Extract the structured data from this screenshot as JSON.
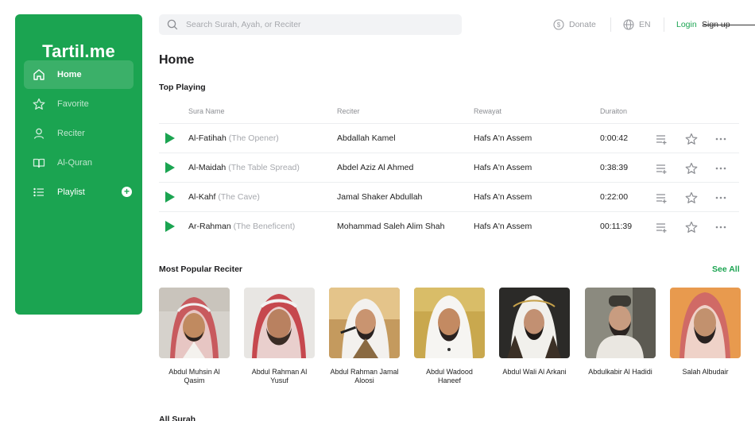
{
  "app": {
    "logo": "Tartil.me",
    "accent": "#1ba451"
  },
  "sidebar": {
    "items": [
      {
        "label": "Home",
        "icon": "home-icon",
        "active": true
      },
      {
        "label": "Favorite",
        "icon": "star-icon",
        "active": false
      },
      {
        "label": "Reciter",
        "icon": "user-icon",
        "active": false
      },
      {
        "label": "Al-Quran",
        "icon": "book-icon",
        "active": false
      },
      {
        "label": "Playlist",
        "icon": "list-icon",
        "active": false,
        "action_icon": "plus-icon"
      }
    ]
  },
  "header": {
    "search_placeholder": "Search Surah, Ayah, or Reciter",
    "donate_label": "Donate",
    "language_label": "EN",
    "login_label": "Login",
    "signup_label": "Sign up"
  },
  "main": {
    "title": "Home",
    "top_playing": {
      "title": "Top Playing",
      "columns": [
        "Sura Name",
        "Reciter",
        "Rewayat",
        "Duraiton"
      ],
      "rows": [
        {
          "sura": "Al-Fatihah",
          "meaning": "(The Opener)",
          "reciter": "Abdallah Kamel",
          "rewayat": "Hafs A'n Assem",
          "duration": "0:00:42"
        },
        {
          "sura": "Al-Maidah",
          "meaning": "(The Table Spread)",
          "reciter": "Abdel Aziz Al Ahmed",
          "rewayat": "Hafs A'n Assem",
          "duration": "0:38:39"
        },
        {
          "sura": "Al-Kahf",
          "meaning": "(The Cave)",
          "reciter": "Jamal Shaker Abdullah",
          "rewayat": "Hafs A'n Assem",
          "duration": "0:22:00"
        },
        {
          "sura": "Ar-Rahman",
          "meaning": "(The Beneficent)",
          "reciter": "Mohammad Saleh Alim Shah",
          "rewayat": "Hafs A'n Assem",
          "duration": "00:11:39"
        }
      ]
    },
    "popular_reciters": {
      "title": "Most Popular Reciter",
      "see_all_label": "See All",
      "reciters": [
        {
          "name": "Abdul Muhsin Al Qasim"
        },
        {
          "name": "Abdul Rahman Al Yusuf"
        },
        {
          "name": "Abdul Rahman Jamal Aloosi"
        },
        {
          "name": "Abdul Wadood Haneef"
        },
        {
          "name": "Abdul Wali Al Arkani"
        },
        {
          "name": "Abdulkabir Al Hadidi"
        },
        {
          "name": "Salah Albudair"
        }
      ]
    },
    "all_surah": {
      "title": "All Surah"
    }
  }
}
